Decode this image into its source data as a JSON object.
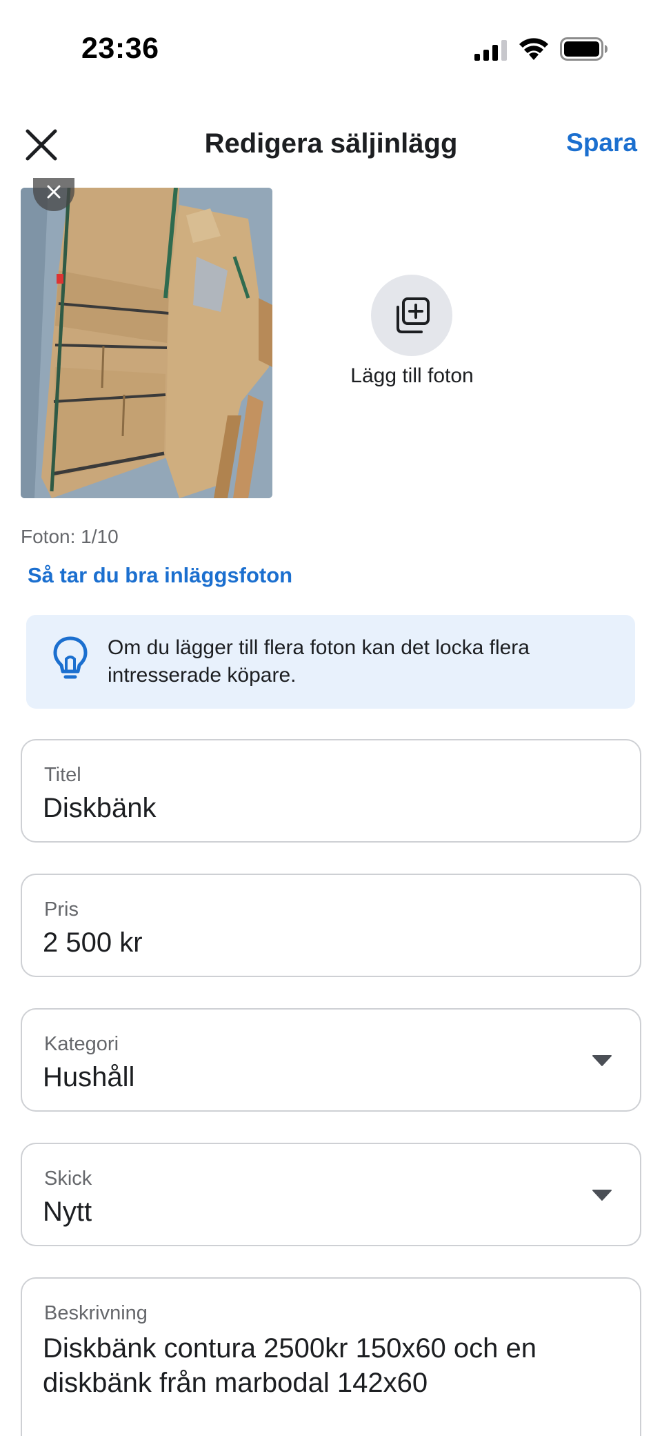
{
  "status_bar": {
    "time": "23:36"
  },
  "header": {
    "title": "Redigera säljinlägg",
    "save_label": "Spara"
  },
  "photos": {
    "add_label": "Lägg till foton",
    "count_text": "Foton: 1/10",
    "tips_link": "Så tar du bra inläggsfoton"
  },
  "info_banner": {
    "text": "Om du lägger till flera foton kan det locka flera intresserade köpare."
  },
  "form": {
    "title": {
      "label": "Titel",
      "value": "Diskbänk"
    },
    "price": {
      "label": "Pris",
      "value": "2 500 kr"
    },
    "category": {
      "label": "Kategori",
      "value": "Hushåll"
    },
    "condition": {
      "label": "Skick",
      "value": "Nytt"
    },
    "description": {
      "label": "Beskrivning",
      "value": "Diskbänk contura 2500kr 150x60 och en diskbänk från marbodal 142x60"
    }
  },
  "colors": {
    "accent": "#1b6fcf",
    "banner_bg": "#e8f1fc",
    "border": "#ced0d4",
    "muted_text": "#65676b"
  }
}
